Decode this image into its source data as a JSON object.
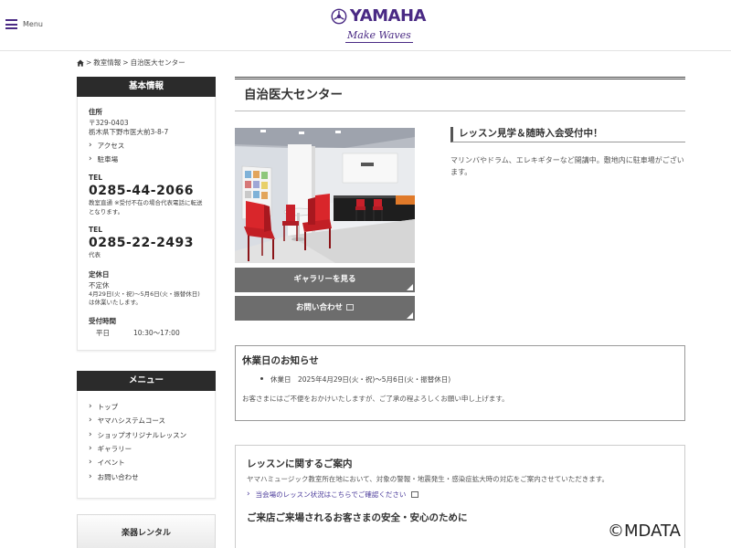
{
  "header": {
    "menu_label": "Menu",
    "logo_text": "YAMAHA",
    "logo_tagline": "Make Waves"
  },
  "breadcrumb": {
    "sep1": ">",
    "item1": "教室情報",
    "sep2": ">",
    "item2": "自治医大センター"
  },
  "sidebar": {
    "basic_title": "基本情報",
    "address_label": "住所",
    "postal": "〒329-0403",
    "address": "栃木県下野市医大前3-8-7",
    "access_link": "アクセス",
    "parking_link": "駐車場",
    "tel1_label": "TEL",
    "tel1": "0285-44-2066",
    "tel1_note": "教室直通 ※受付不在の場合代表電話に転送となります。",
    "tel2_label": "TEL",
    "tel2": "0285-22-2493",
    "tel2_note": "代表",
    "closed_label": "定休日",
    "closed_value": "不定休",
    "closed_note": "4月29日(火・祝)〜5月6日(火・振替休日)は休業いたします。",
    "hours_label": "受付時間",
    "hours_day": "平日",
    "hours_time": "10:30〜17:00",
    "menu_title": "メニュー",
    "menu_items": [
      {
        "label": "トップ"
      },
      {
        "label": "ヤマハシステムコース"
      },
      {
        "label": "ショップオリジナルレッスン"
      },
      {
        "label": "ギャラリー"
      },
      {
        "label": "イベント"
      },
      {
        "label": "お問い合わせ"
      }
    ],
    "rental_label": "楽器レンタル"
  },
  "main": {
    "page_title": "自治医大センター",
    "gallery_button": "ギャラリーを見る",
    "contact_button": "お問い合わせ",
    "catch_title": "レッスン見学＆随時入会受付中！",
    "catch_body": "マリンバやドラム、エレキギターなど開講中。敷地内に駐車場がございます。",
    "notice_title": "休業日のお知らせ",
    "notice_item": "休業日　2025年4月29日(火・祝)〜5月6日(火・振替休日)",
    "notice_text": "お客さまにはご不便をおかけいたしますが、ご了承の程よろしくお願い申し上げます。",
    "lesson_title": "レッスンに関するご案内",
    "lesson_text": "ヤマハミュージック教室所在地において、対象の警報・地震発生・感染症拡大時の対応をご案内させていただきます。",
    "lesson_link": "当会場のレッスン状況はこちらでご確認ください",
    "safety_title": "ご来店ご来場されるお客さまの安全・安心のために"
  },
  "watermark": "©MDATA",
  "colors": {
    "brand": "#4a2a84",
    "dark_header": "#2b2b2b",
    "button_gray": "#6d6d6d",
    "chair_red": "#d9262b"
  }
}
